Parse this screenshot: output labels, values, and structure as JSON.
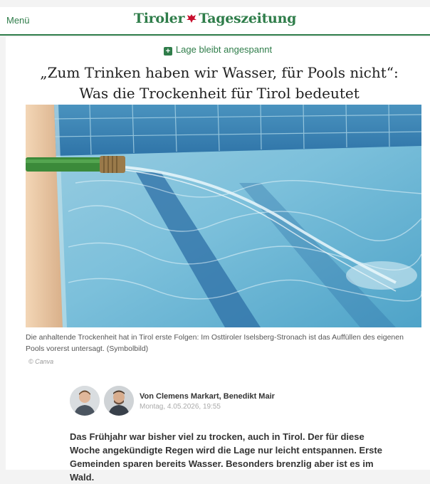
{
  "header": {
    "menu_label": "Menü",
    "logo_left": "Tiroler",
    "logo_right": "Tageszeitung"
  },
  "article": {
    "kicker": "Lage bleibt angespannt",
    "kicker_icon": "plus-icon",
    "headline": "„Zum Trinken haben wir Wasser, für Pools nicht“: Was die Trockenheit für Tirol bedeutet",
    "image_caption": "Die anhaltende Trockenheit hat in Tirol erste Folgen: Im Osttiroler Iselsberg-Stronach ist das Auffüllen des eigenen Pools vorerst untersagt. (Symbolbild)",
    "image_credit": "© Canva",
    "byline": "Von Clemens Markart, Benedikt Mair",
    "date": "Montag, 4.05.2026, 19:55",
    "lead": "Das Frühjahr war bisher viel zu trocken, auch in Tirol. Der für diese Woche angekündigte Regen wird die Lage nur leicht entspannen. Erste Gemeinden sparen bereits Wasser. Besonders brenzlig aber ist es im Wald."
  },
  "colors": {
    "brand_green": "#2f7d4a",
    "logo_eagle_red": "#c8102e"
  }
}
